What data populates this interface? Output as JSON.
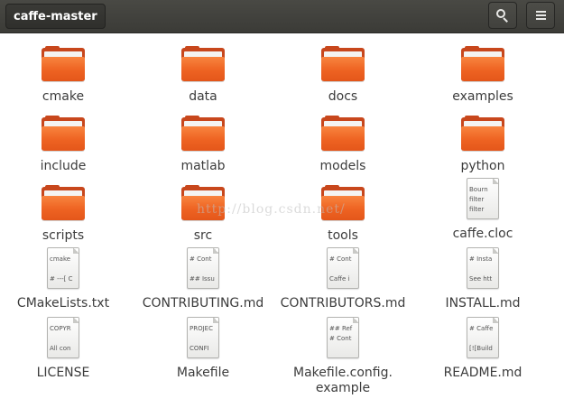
{
  "header": {
    "path_label": "caffe-master",
    "search_icon": "search-icon",
    "menu_icon": "hamburger-menu-icon"
  },
  "items": [
    {
      "name": "cmake",
      "type": "folder"
    },
    {
      "name": "data",
      "type": "folder"
    },
    {
      "name": "docs",
      "type": "folder"
    },
    {
      "name": "examples",
      "type": "folder"
    },
    {
      "name": "include",
      "type": "folder"
    },
    {
      "name": "matlab",
      "type": "folder"
    },
    {
      "name": "models",
      "type": "folder"
    },
    {
      "name": "python",
      "type": "folder"
    },
    {
      "name": "scripts",
      "type": "folder"
    },
    {
      "name": "src",
      "type": "folder"
    },
    {
      "name": "tools",
      "type": "folder"
    },
    {
      "name": "caffe.cloc",
      "type": "file",
      "preview": [
        "Bourn",
        "filter",
        "filter"
      ]
    },
    {
      "name": "CMakeLists.txt",
      "type": "file",
      "preview": [
        "cmake",
        "",
        "# ---[ C"
      ]
    },
    {
      "name": "CONTRIBUTING.md",
      "type": "file",
      "preview": [
        "# Cont",
        "",
        "## Issu"
      ]
    },
    {
      "name": "CONTRIBUTORS.md",
      "type": "file",
      "preview": [
        "# Cont",
        "",
        "Caffe i"
      ]
    },
    {
      "name": "INSTALL.md",
      "type": "file",
      "preview": [
        "# Insta",
        "",
        "See htt"
      ]
    },
    {
      "name": "LICENSE",
      "type": "file",
      "preview": [
        "COPYR",
        "",
        "All con"
      ]
    },
    {
      "name": "Makefile",
      "type": "file",
      "preview": [
        "PROJEC",
        "",
        "CONFI"
      ]
    },
    {
      "name": "Makefile.config.\nexample",
      "type": "file",
      "preview": [
        "## Ref",
        "# Cont",
        ""
      ]
    },
    {
      "name": "README.md",
      "type": "file",
      "preview": [
        "# Caffe",
        "",
        "[![Build"
      ]
    }
  ],
  "watermark": "http://blog.csdn.net/",
  "colors": {
    "header_bg": "#3b3b37",
    "folder_orange": "#ee6322",
    "label_text": "#3c3c3c"
  }
}
